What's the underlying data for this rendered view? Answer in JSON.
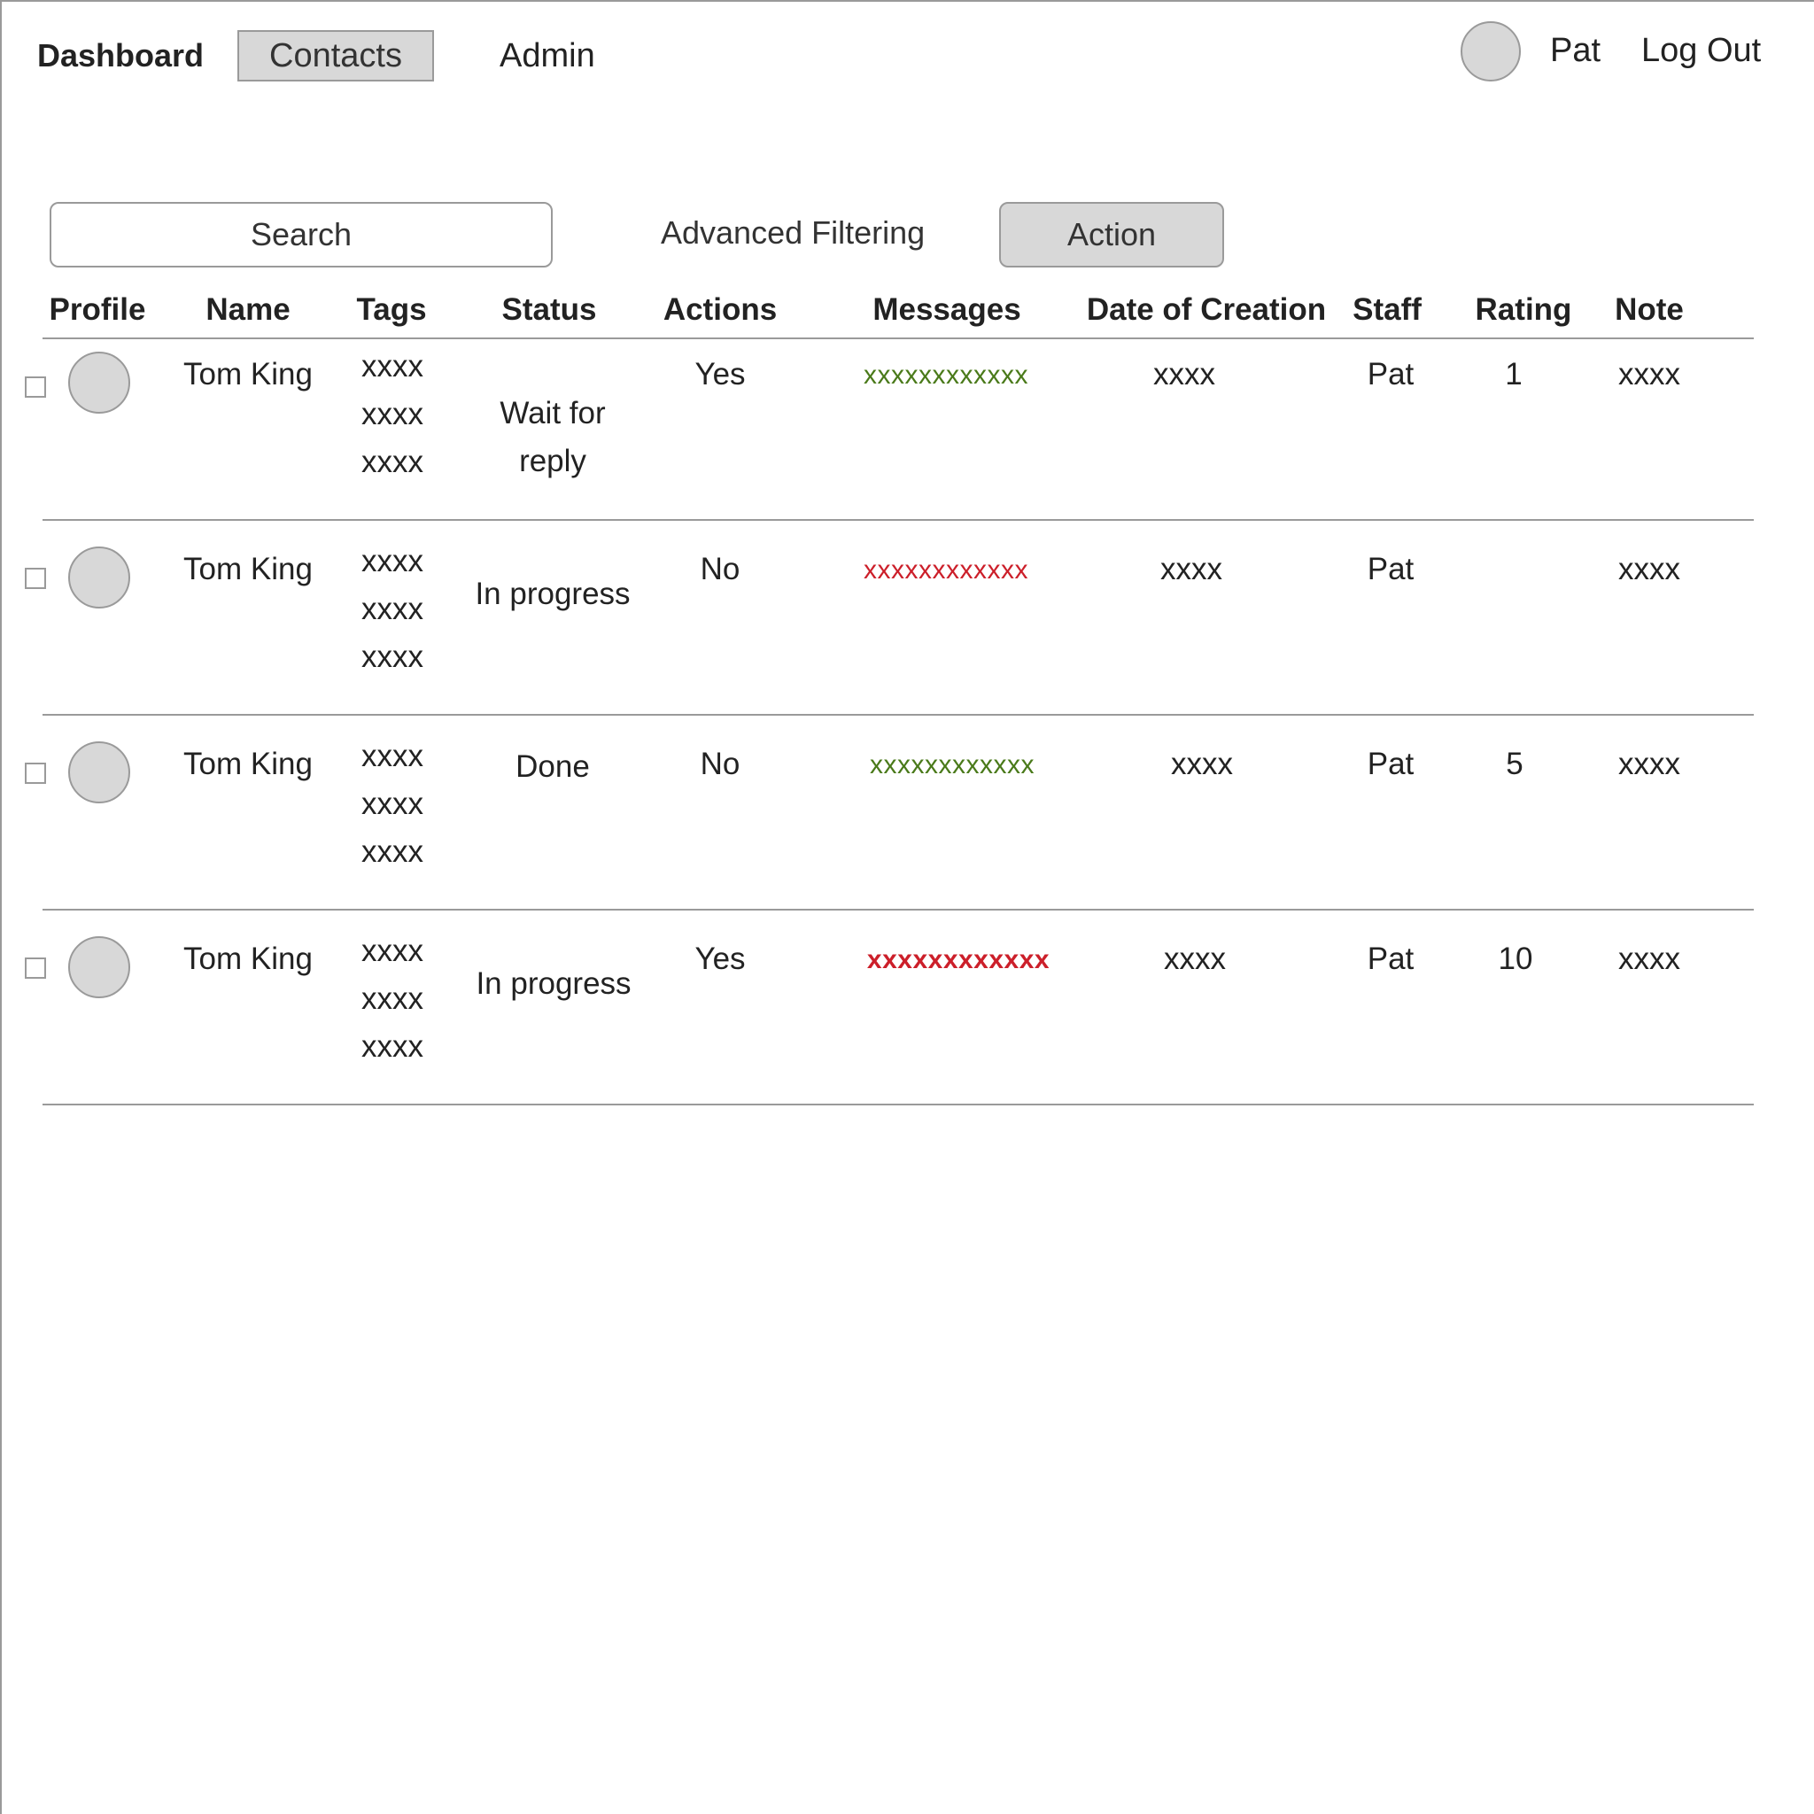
{
  "nav": {
    "dashboard": "Dashboard",
    "contacts": "Contacts",
    "admin": "Admin",
    "user_name": "Pat",
    "logout": "Log Out"
  },
  "toolbar": {
    "search_placeholder": "Search",
    "advanced_filtering": "Advanced Filtering",
    "action": "Action"
  },
  "table": {
    "headers": [
      "Profile",
      "Name",
      "Tags",
      "Status",
      "Actions",
      "Messages",
      "Date of Creation",
      "Staff",
      "Rating",
      "Note"
    ],
    "rows": [
      {
        "name": "Tom King",
        "tags": [
          "xxxx",
          "xxxx",
          "xxxx"
        ],
        "status": "Wait for reply",
        "actions": "Yes",
        "messages": "xxxxxxxxxxxx",
        "message_color": "#4a7a1a",
        "date": "xxxx",
        "staff": "Pat",
        "rating": "1",
        "note": "xxxx"
      },
      {
        "name": "Tom King",
        "tags": [
          "xxxx",
          "xxxx",
          "xxxx"
        ],
        "status": "In progress",
        "actions": "No",
        "messages": "xxxxxxxxxxxx",
        "message_color": "#cc1f2a",
        "date": "xxxx",
        "staff": "Pat",
        "rating": "",
        "note": "xxxx"
      },
      {
        "name": "Tom King",
        "tags": [
          "xxxx",
          "xxxx",
          "xxxx"
        ],
        "status": "Done",
        "actions": "No",
        "messages": "xxxxxxxxxxxx",
        "message_color": "#4a7a1a",
        "date": "xxxx",
        "staff": "Pat",
        "rating": "5",
        "note": "xxxx"
      },
      {
        "name": "Tom King",
        "tags": [
          "xxxx",
          "xxxx",
          "xxxx"
        ],
        "status": "In progress",
        "actions": "Yes",
        "messages": "xxxxxxxxxxxx",
        "message_color": "#cc1f2a",
        "date": "xxxx",
        "staff": "Pat",
        "rating": "10",
        "note": "xxxx"
      }
    ]
  }
}
